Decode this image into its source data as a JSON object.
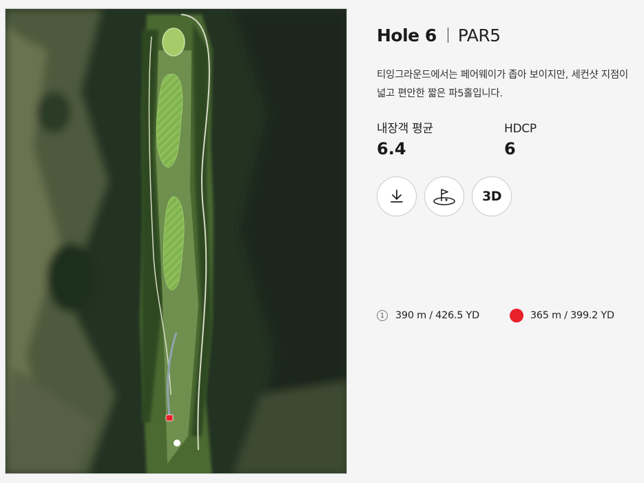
{
  "hole": {
    "title": "Hole 6",
    "par": "PAR5",
    "description": "티잉그라운드에서는 페어웨이가 좁아 보이지만, 세컨샷 지점이 넓고 편안한 짧은 파5홀입니다."
  },
  "stats": {
    "average_label": "내장객 평균",
    "average_value": "6.4",
    "hdcp_label": "HDCP",
    "hdcp_value": "6"
  },
  "actions": [
    {
      "icon": "download-icon"
    },
    {
      "icon": "flag-green-icon"
    },
    {
      "label": "3D"
    }
  ],
  "distances": [
    {
      "marker": "1",
      "text": "390 m / 426.5 YD"
    },
    {
      "marker_color": "#e8202a",
      "text": "365 m / 399.2 YD"
    }
  ],
  "colors": {
    "red_tee": "#e8202a",
    "fairway": "#7fb24e"
  }
}
